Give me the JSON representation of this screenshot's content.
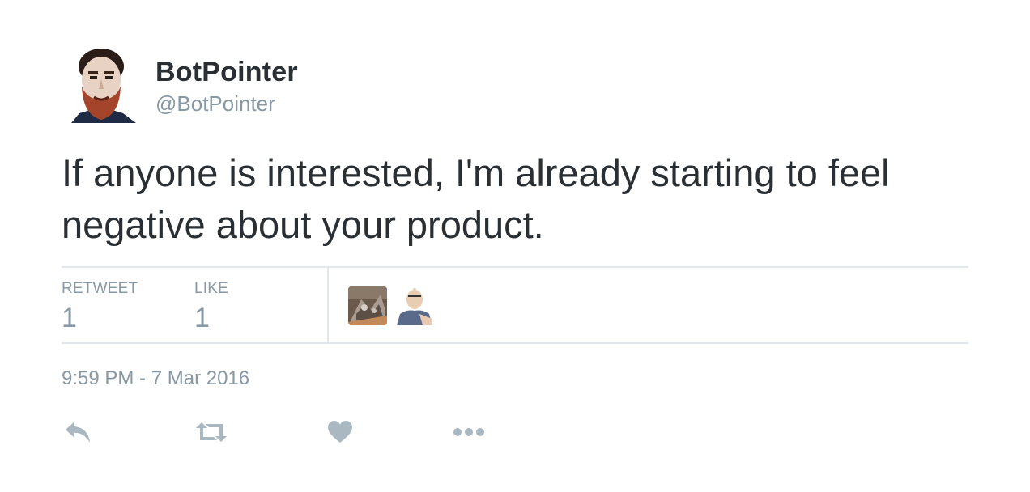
{
  "author": {
    "display_name": "BotPointer",
    "handle": "@BotPointer"
  },
  "tweet": {
    "text": "If anyone is interested, I'm already starting to feel negative about your product.",
    "timestamp": "9:59 PM - 7 Mar 2016"
  },
  "stats": {
    "retweet_label": "RETWEET",
    "retweet_count": "1",
    "like_label": "LIKE",
    "like_count": "1"
  },
  "actions": {
    "reply_icon": "reply-icon",
    "retweet_icon": "retweet-icon",
    "like_icon": "heart-icon",
    "more_icon": "more-dots-icon"
  },
  "colors": {
    "text": "#292f33",
    "muted": "#8899a6",
    "divider": "#e1e8ed",
    "icon": "#aab8c2"
  }
}
